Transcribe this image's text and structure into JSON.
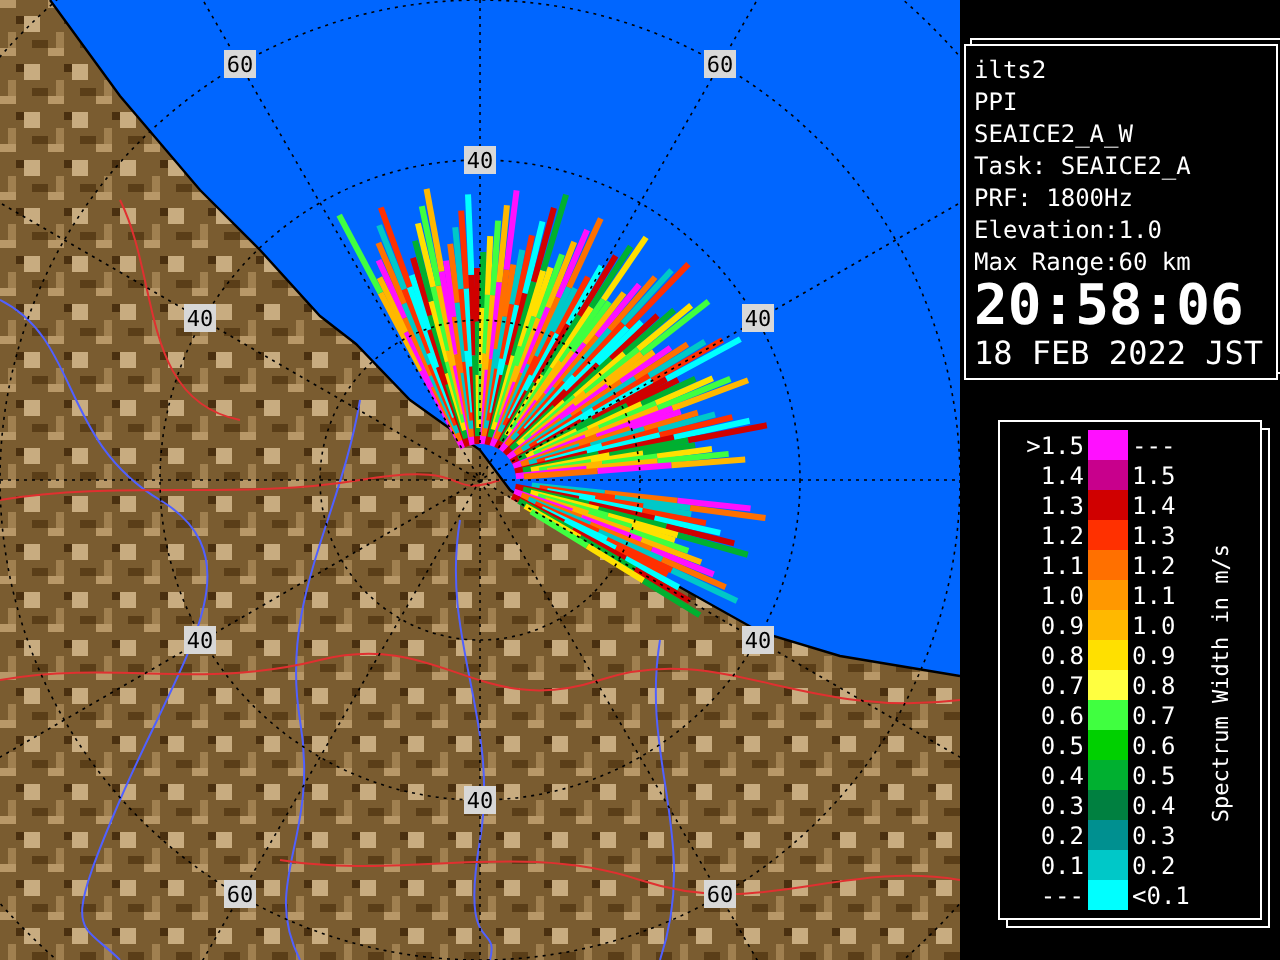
{
  "radar": {
    "ring_labels": [
      "60",
      "60",
      "40",
      "40",
      "40",
      "40",
      "40",
      "40",
      "60",
      "60"
    ]
  },
  "info": {
    "lines": [
      "ilts2",
      "PPI",
      "SEAICE2_A_W",
      "Task: SEAICE2_A",
      "PRF: 1800Hz",
      "Elevation:1.0",
      "Max Range:60 km"
    ],
    "time": "20:58:06",
    "date": "18 FEB 2022 JST"
  },
  "legend": {
    "title": "Spectrum Width in m/s",
    "rows": [
      {
        "low": ">1.5",
        "high": "---",
        "color": "#ff10ff"
      },
      {
        "low": "1.4",
        "high": "1.5",
        "color": "#c8008c"
      },
      {
        "low": "1.3",
        "high": "1.4",
        "color": "#d00000"
      },
      {
        "low": "1.2",
        "high": "1.3",
        "color": "#ff3000"
      },
      {
        "low": "1.1",
        "high": "1.2",
        "color": "#ff7000"
      },
      {
        "low": "1.0",
        "high": "1.1",
        "color": "#ff9800"
      },
      {
        "low": "0.9",
        "high": "1.0",
        "color": "#ffb800"
      },
      {
        "low": "0.8",
        "high": "0.9",
        "color": "#ffe000"
      },
      {
        "low": "0.7",
        "high": "0.8",
        "color": "#ffff40"
      },
      {
        "low": "0.6",
        "high": "0.7",
        "color": "#40ff40"
      },
      {
        "low": "0.5",
        "high": "0.6",
        "color": "#00d000"
      },
      {
        "low": "0.4",
        "high": "0.5",
        "color": "#00b030"
      },
      {
        "low": "0.3",
        "high": "0.4",
        "color": "#008040"
      },
      {
        "low": "0.2",
        "high": "0.3",
        "color": "#009090"
      },
      {
        "low": "0.1",
        "high": "0.2",
        "color": "#00c8c8"
      },
      {
        "low": "---",
        "high": "<0.1",
        "color": "#00ffff"
      }
    ]
  }
}
